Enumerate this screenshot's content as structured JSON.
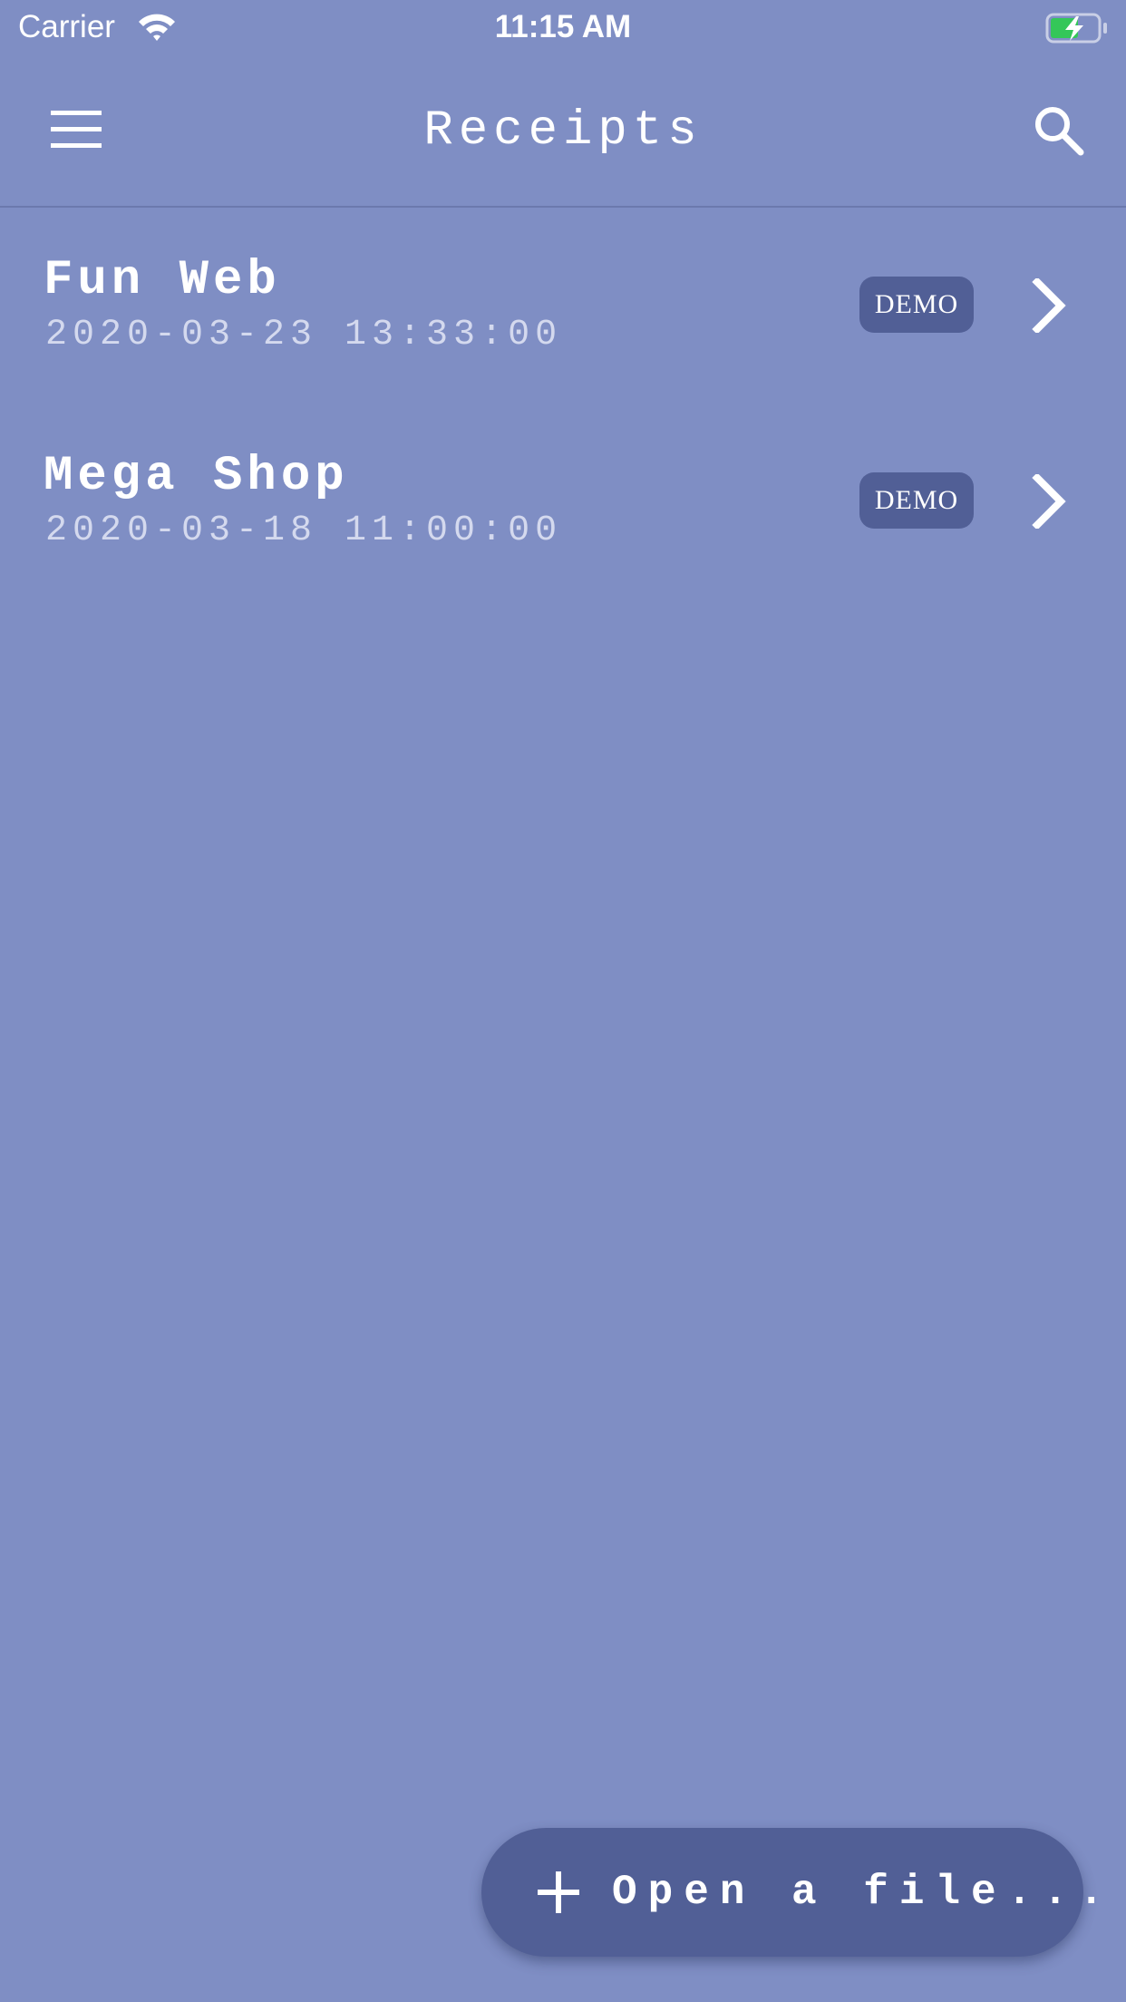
{
  "status_bar": {
    "carrier": "Carrier",
    "time": "11:15 AM",
    "wifi_icon": "wifi-icon",
    "battery_icon": "battery-charging-icon",
    "battery_fill_color": "#34c759"
  },
  "app_bar": {
    "title": "Receipts",
    "menu_icon": "hamburger-menu-icon",
    "search_icon": "search-icon"
  },
  "receipts": [
    {
      "name": "Fun Web",
      "date": "2020-03-23 13:33:00",
      "badge": "DEMO"
    },
    {
      "name": "Mega Shop",
      "date": "2020-03-18 11:00:00",
      "badge": "DEMO"
    }
  ],
  "fab": {
    "label": "Open a file...",
    "icon": "plus-icon"
  },
  "colors": {
    "background": "#7f8ec4",
    "badge": "#515f96",
    "fab": "#515f96",
    "text": "#ffffff",
    "secondary_text": "#d4d9ee"
  }
}
